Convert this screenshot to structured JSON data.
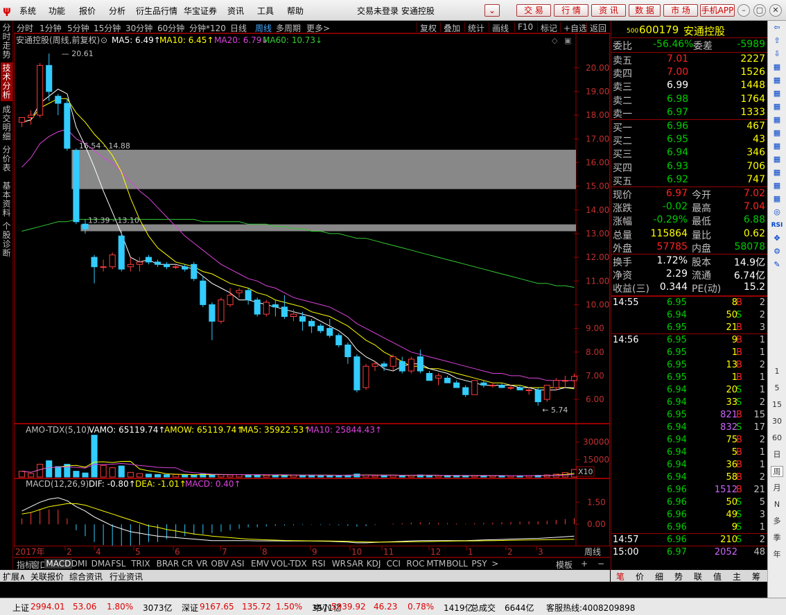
{
  "menu": [
    "系统",
    "功能",
    "报价",
    "分析",
    "衍生品行情",
    "华宝证券",
    "资讯",
    "工具",
    "帮助"
  ],
  "window_title": "交易未登录  安通控股",
  "top_buttons": [
    "交 易",
    "行 情",
    "资 讯",
    "数 据",
    "市 场",
    "手机APP"
  ],
  "left_tabs": [
    "分时走势",
    "技术分析",
    "成交明细",
    "分价表",
    "基本资料",
    "个股诊断"
  ],
  "periods": [
    "分时",
    "1分钟",
    "5分钟",
    "15分钟",
    "30分钟",
    "60分钟",
    "分钟*120",
    "日线",
    "周线",
    "多周期",
    "更多>"
  ],
  "right_tools": [
    "复权",
    "叠加",
    "统计",
    "画线",
    "F10",
    "标记",
    "+自选",
    "返回"
  ],
  "chart_header": {
    "name": "安通控股(周线,前复权)",
    "ma5": "MA5: 6.49↑",
    "ma10": "MA10: 6.45↑",
    "ma20": "MA20: 6.79↓",
    "ma60": "MA60: 10.73↓"
  },
  "annotations": {
    "high": "20.61",
    "low": "5.74",
    "gap1": "16.54 - 14.88",
    "gap2": "13.39 - 13.10"
  },
  "vol_header": {
    "name": "AMO-TDX(5,10)",
    "vamo": "VAMO: 65119.74↑",
    "amow": "AMOW: 65119.74↑",
    "ma5": "MA5: 35922.53↑",
    "ma10": "MA10: 25844.43↑",
    "x10": "X10"
  },
  "macd_header": {
    "name": "MACD(12,26,9)",
    "dif": "DIF: -0.80↑",
    "dea": "DEA: -1.01↑",
    "macd": "MACD: 0.40↑"
  },
  "x_labels": [
    "2017年",
    "2",
    "4",
    "5",
    "6",
    "7",
    "8",
    "9",
    "10",
    "11",
    "12",
    "1",
    "2",
    "3"
  ],
  "bottom_right_label": "周线",
  "indicator_tabs": [
    "指标",
    "窗口",
    "MACD",
    "DMI",
    "DMA",
    "FSL",
    "TRIX",
    "BRAR",
    "CR",
    "VR",
    "OBV",
    "ASI",
    "EMV",
    "VOL-TDX",
    "RSI",
    "WR",
    "SAR",
    "KDJ",
    "CCI",
    "ROC",
    "MTM",
    "BOLL",
    "PSY",
    ">"
  ],
  "template_label": "模板",
  "bottom_links": [
    "扩展∧",
    "关联报价",
    "综合资讯",
    "行业资讯"
  ],
  "quote": {
    "code": "600179",
    "name": "安通控股",
    "badge": "500",
    "webi_label": "委比",
    "webi": "-56.46%",
    "wecha_label": "委差",
    "wecha": "-5989",
    "sell": [
      {
        "label": "卖五",
        "price": "7.01",
        "vol": "2227"
      },
      {
        "label": "卖四",
        "price": "7.00",
        "vol": "1526"
      },
      {
        "label": "卖三",
        "price": "6.99",
        "vol": "1448"
      },
      {
        "label": "卖二",
        "price": "6.98",
        "vol": "1764"
      },
      {
        "label": "卖一",
        "price": "6.97",
        "vol": "1333"
      }
    ],
    "buy": [
      {
        "label": "买一",
        "price": "6.96",
        "vol": "467"
      },
      {
        "label": "买二",
        "price": "6.95",
        "vol": "43"
      },
      {
        "label": "买三",
        "price": "6.94",
        "vol": "346"
      },
      {
        "label": "买四",
        "price": "6.93",
        "vol": "706"
      },
      {
        "label": "买五",
        "price": "6.92",
        "vol": "747"
      }
    ],
    "stats": [
      {
        "l1": "现价",
        "v1": "6.97",
        "l2": "今开",
        "v2": "7.02"
      },
      {
        "l1": "涨跌",
        "v1": "-0.02",
        "l2": "最高",
        "v2": "7.04"
      },
      {
        "l1": "涨幅",
        "v1": "-0.29%",
        "l2": "最低",
        "v2": "6.88"
      },
      {
        "l1": "总量",
        "v1": "115864",
        "l2": "量比",
        "v2": "0.62"
      },
      {
        "l1": "外盘",
        "v1": "57785",
        "l2": "内盘",
        "v2": "58078"
      }
    ],
    "fund": [
      {
        "l1": "换手",
        "v1": "1.72%",
        "l2": "股本",
        "v2": "14.9亿"
      },
      {
        "l1": "净资",
        "v1": "2.29",
        "l2": "流通",
        "v2": "6.74亿"
      },
      {
        "l1": "收益(三)",
        "v1": "0.344",
        "l2": "PE(动)",
        "v2": "15.2"
      }
    ]
  },
  "ticks": [
    {
      "time": "14:55",
      "price": "6.95",
      "vol": "8",
      "bs": "B",
      "n": "2"
    },
    {
      "time": "",
      "price": "6.94",
      "vol": "50",
      "bs": "S",
      "n": "2"
    },
    {
      "time": "",
      "price": "6.95",
      "vol": "21",
      "bs": "B",
      "n": "3"
    },
    {
      "time": "14:56",
      "price": "6.95",
      "vol": "9",
      "bs": "B",
      "n": "1"
    },
    {
      "time": "",
      "price": "6.95",
      "vol": "1",
      "bs": "B",
      "n": "1"
    },
    {
      "time": "",
      "price": "6.95",
      "vol": "13",
      "bs": "B",
      "n": "2"
    },
    {
      "time": "",
      "price": "6.95",
      "vol": "1",
      "bs": "B",
      "n": "1"
    },
    {
      "time": "",
      "price": "6.94",
      "vol": "20",
      "bs": "S",
      "n": "1"
    },
    {
      "time": "",
      "price": "6.94",
      "vol": "33",
      "bs": "S",
      "n": "2"
    },
    {
      "time": "",
      "price": "6.95",
      "vol": "821",
      "bs": "B",
      "n": "15"
    },
    {
      "time": "",
      "price": "6.94",
      "vol": "832",
      "bs": "S",
      "n": "17"
    },
    {
      "time": "",
      "price": "6.94",
      "vol": "75",
      "bs": "B",
      "n": "2"
    },
    {
      "time": "",
      "price": "6.94",
      "vol": "5",
      "bs": "B",
      "n": "1"
    },
    {
      "time": "",
      "price": "6.94",
      "vol": "36",
      "bs": "B",
      "n": "1"
    },
    {
      "time": "",
      "price": "6.94",
      "vol": "58",
      "bs": "B",
      "n": "2"
    },
    {
      "time": "",
      "price": "6.96",
      "vol": "1512",
      "bs": "B",
      "n": "21"
    },
    {
      "time": "",
      "price": "6.96",
      "vol": "50",
      "bs": "S",
      "n": "5"
    },
    {
      "time": "",
      "price": "6.96",
      "vol": "49",
      "bs": "S",
      "n": "3"
    },
    {
      "time": "",
      "price": "6.96",
      "vol": "9",
      "bs": "S",
      "n": "1"
    },
    {
      "time": "14:57",
      "price": "6.96",
      "vol": "210",
      "bs": "S",
      "n": "2"
    },
    {
      "time": "15:00",
      "price": "6.97",
      "vol": "2052",
      "bs": "",
      "n": "48"
    }
  ],
  "right_bottom_tabs": [
    "笔",
    "价",
    "细",
    "势",
    "联",
    "值",
    "主",
    "筹"
  ],
  "tool_icons": [
    "arrow-left-icon",
    "arrow-up-icon",
    "arrow-down-icon",
    "grid-icon",
    "grid-icon",
    "grid-icon",
    "grid-icon",
    "grid-icon",
    "grid-icon",
    "grid-icon",
    "grid-icon",
    "grid-icon",
    "grid-icon",
    "grid-icon",
    "circle-icon",
    "RSI",
    "cross-icon",
    "tool-icon",
    "pen-icon"
  ],
  "tool_labels": [
    "1",
    "5",
    "15",
    "30",
    "60",
    "日",
    "周",
    "月",
    "N",
    "多",
    "季",
    "年"
  ],
  "index_bar": [
    {
      "name": "上证",
      "val": "2994.01",
      "chg": "53.06",
      "pct": "1.80%",
      "amt": "3073亿"
    },
    {
      "name": "深证",
      "val": "9167.65",
      "chg": "135.72",
      "pct": "1.50%",
      "amt": "3571亿"
    },
    {
      "name": "中小",
      "val": "5939.92",
      "chg": "46.23",
      "pct": "0.78%",
      "amt": "1419亿"
    }
  ],
  "total_label": "总成交",
  "total_amt": "6644亿",
  "hotline": "客服热线:4008209898",
  "chart_data": {
    "type": "candlestick",
    "y_ticks": [
      "20.00",
      "19.00",
      "18.00",
      "17.00",
      "16.00",
      "15.00",
      "14.00",
      "13.00",
      "12.00",
      "11.00",
      "10.00",
      "9.00",
      "8.00",
      "7.00",
      "6.00"
    ],
    "ylim": [
      5.3,
      20.9
    ],
    "vol_ticks": [
      "30000",
      "15000"
    ],
    "vol_ylim": [
      0,
      37000
    ],
    "macd_ticks": [
      "1.50",
      "0.00"
    ],
    "macd_ylim": [
      -1.35,
      2.5
    ],
    "candles": [
      [
        17.7,
        17.9,
        17.5,
        17.9
      ],
      [
        17.9,
        18.2,
        17.6,
        18.0
      ],
      [
        18.0,
        20.2,
        17.9,
        20.1
      ],
      [
        20.1,
        20.6,
        18.6,
        19.0
      ],
      [
        18.8,
        18.9,
        18.0,
        18.5
      ],
      [
        18.5,
        18.7,
        16.5,
        16.6
      ],
      [
        16.5,
        16.6,
        13.4,
        13.5
      ],
      [
        13.4,
        13.6,
        13.0,
        13.2
      ],
      [
        12.0,
        12.1,
        10.9,
        11.6
      ],
      [
        11.6,
        11.9,
        11.4,
        11.6
      ],
      [
        11.6,
        12.2,
        11.5,
        12.1
      ],
      [
        12.9,
        13.1,
        11.4,
        11.5
      ],
      [
        11.6,
        12.0,
        11.4,
        11.7
      ],
      [
        11.7,
        12.0,
        11.4,
        11.8
      ],
      [
        12.0,
        12.1,
        11.7,
        11.8
      ],
      [
        11.8,
        11.9,
        11.6,
        11.7
      ],
      [
        11.7,
        11.8,
        11.5,
        11.6
      ],
      [
        11.6,
        11.7,
        11.5,
        11.6
      ],
      [
        11.6,
        11.7,
        11.4,
        11.5
      ],
      [
        11.7,
        11.8,
        11.0,
        11.1
      ],
      [
        11.0,
        11.2,
        9.9,
        10.0
      ],
      [
        10.0,
        10.1,
        8.5,
        9.3
      ],
      [
        9.3,
        10.3,
        9.2,
        10.2
      ],
      [
        10.0,
        10.7,
        9.9,
        10.4
      ],
      [
        10.5,
        10.7,
        10.3,
        10.6
      ],
      [
        10.6,
        10.7,
        10.0,
        10.2
      ],
      [
        10.2,
        10.3,
        9.5,
        9.6
      ],
      [
        9.6,
        10.2,
        9.5,
        10.1
      ],
      [
        10.0,
        10.2,
        9.5,
        9.9
      ],
      [
        9.9,
        10.4,
        9.4,
        9.5
      ],
      [
        9.5,
        9.8,
        9.3,
        9.6
      ],
      [
        9.5,
        9.7,
        8.9,
        9.3
      ],
      [
        9.3,
        9.4,
        8.8,
        9.1
      ],
      [
        9.1,
        9.2,
        8.8,
        8.9
      ],
      [
        9.0,
        9.4,
        8.6,
        8.7
      ],
      [
        8.7,
        8.8,
        8.2,
        8.3
      ],
      [
        8.3,
        8.4,
        7.5,
        7.8
      ],
      [
        7.8,
        7.9,
        6.3,
        6.4
      ],
      [
        6.5,
        7.5,
        6.4,
        7.4
      ],
      [
        7.4,
        7.6,
        7.2,
        7.5
      ],
      [
        7.5,
        7.6,
        7.2,
        7.4
      ],
      [
        7.4,
        7.9,
        7.2,
        7.8
      ],
      [
        7.6,
        7.8,
        7.1,
        7.2
      ],
      [
        7.2,
        7.8,
        7.1,
        7.7
      ],
      [
        7.8,
        8.1,
        7.1,
        7.2
      ],
      [
        7.1,
        7.2,
        6.8,
        6.8
      ],
      [
        6.9,
        7.1,
        6.6,
        7.0
      ],
      [
        6.9,
        7.0,
        6.7,
        6.7
      ],
      [
        6.7,
        6.8,
        6.5,
        6.5
      ],
      [
        6.5,
        6.6,
        6.1,
        6.2
      ],
      [
        6.2,
        6.8,
        6.2,
        6.8
      ],
      [
        6.7,
        6.8,
        6.5,
        6.6
      ],
      [
        6.6,
        6.7,
        6.5,
        6.6
      ],
      [
        6.6,
        6.7,
        6.5,
        6.5
      ],
      [
        6.5,
        6.6,
        6.4,
        6.5
      ],
      [
        6.5,
        6.6,
        6.4,
        6.4
      ],
      [
        6.4,
        6.5,
        6.2,
        6.4
      ],
      [
        6.4,
        6.5,
        5.74,
        5.9
      ],
      [
        6.0,
        6.6,
        5.9,
        6.6
      ],
      [
        6.5,
        6.9,
        6.4,
        6.8
      ],
      [
        6.8,
        7.0,
        6.5,
        6.8
      ],
      [
        6.8,
        7.1,
        6.5,
        6.97
      ]
    ],
    "volumes": [
      5000,
      3000,
      11000,
      14000,
      9000,
      11000,
      5000,
      3500,
      36000,
      10000,
      8000,
      9500,
      4000,
      3000,
      2500,
      2200,
      2000,
      2200,
      2000,
      1800,
      2500,
      2200,
      2000,
      1800,
      2000,
      1900,
      1700,
      1500,
      1600,
      1800,
      1700,
      1600,
      1500,
      1400,
      1500,
      1400,
      1600,
      2600,
      1800,
      1300,
      1200,
      1600,
      1300,
      1500,
      1800,
      1200,
      1300,
      1200,
      1100,
      1300,
      1400,
      1200,
      1200,
      1100,
      1100,
      1200,
      1300,
      1500,
      1800,
      2400,
      3800,
      6500
    ],
    "ma5": [
      17.7,
      17.8,
      18.5,
      18.8,
      19.1,
      18.9,
      17.5,
      16.7,
      15.8,
      14.8,
      13.9,
      13.0,
      12.0,
      11.8,
      11.9,
      11.7,
      11.7,
      11.7,
      11.6,
      11.5,
      11.2,
      10.9,
      10.7,
      10.5,
      10.2,
      10.2,
      10.1,
      10.0,
      9.9,
      9.8,
      9.7,
      9.6,
      9.5,
      9.3,
      9.1,
      8.9,
      8.6,
      8.1,
      7.8,
      7.6,
      7.3,
      7.2,
      7.4,
      7.5,
      7.5,
      7.3,
      7.2,
      7.1,
      6.9,
      6.8,
      6.7,
      6.6,
      6.6,
      6.6,
      6.6,
      6.5,
      6.5,
      6.4,
      6.4,
      6.4,
      6.5,
      6.49
    ],
    "ma10": [
      17.7,
      17.8,
      18.3,
      18.5,
      18.7,
      18.7,
      18.1,
      17.7,
      17.2,
      16.8,
      16.3,
      15.6,
      14.5,
      13.6,
      12.9,
      12.4,
      12.1,
      11.8,
      11.7,
      11.6,
      11.4,
      11.3,
      11.1,
      10.9,
      10.8,
      10.7,
      10.5,
      10.4,
      10.2,
      10.1,
      10.0,
      9.9,
      9.7,
      9.6,
      9.5,
      9.3,
      9.1,
      8.8,
      8.5,
      8.3,
      8.0,
      7.8,
      7.6,
      7.4,
      7.4,
      7.3,
      7.3,
      7.2,
      7.1,
      7.0,
      6.9,
      6.8,
      6.7,
      6.7,
      6.6,
      6.6,
      6.5,
      6.5,
      6.5,
      6.5,
      6.5,
      6.45
    ],
    "ma20": [
      15.8,
      16.2,
      16.8,
      17.1,
      17.3,
      17.4,
      17.0,
      16.8,
      16.5,
      16.2,
      16.0,
      15.6,
      15.2,
      14.8,
      14.5,
      14.1,
      13.7,
      13.3,
      12.9,
      12.6,
      12.3,
      12.0,
      11.7,
      11.5,
      11.3,
      11.1,
      11.0,
      10.8,
      10.7,
      10.5,
      10.3,
      10.2,
      10.1,
      10.0,
      9.9,
      9.7,
      9.5,
      9.2,
      9.0,
      8.8,
      8.6,
      8.4,
      8.2,
      8.0,
      7.9,
      7.8,
      7.7,
      7.6,
      7.5,
      7.4,
      7.3,
      7.2,
      7.1,
      7.1,
      7.0,
      7.0,
      6.9,
      6.9,
      6.8,
      6.8,
      6.8,
      6.79
    ],
    "ma60": [
      13.1,
      13.2,
      13.3,
      13.4,
      13.5,
      13.5,
      13.6,
      13.6,
      13.6,
      13.6,
      13.6,
      13.6,
      13.6,
      13.6,
      13.6,
      13.6,
      13.6,
      13.6,
      13.6,
      13.6,
      13.5,
      13.5,
      13.5,
      13.5,
      13.5,
      13.4,
      13.4,
      13.4,
      13.3,
      13.3,
      13.2,
      13.2,
      13.1,
      13.1,
      13.0,
      13.0,
      12.9,
      12.8,
      12.8,
      12.7,
      12.6,
      12.5,
      12.4,
      12.3,
      12.2,
      12.1,
      12.0,
      11.9,
      11.8,
      11.7,
      11.6,
      11.5,
      11.4,
      11.3,
      11.2,
      11.1,
      11.0,
      10.9,
      10.9,
      10.8,
      10.8,
      10.73
    ],
    "macd_dif": [
      0.9,
      1.2,
      1.5,
      1.7,
      1.8,
      1.6,
      1.2,
      0.9,
      0.5,
      0.2,
      -0.1,
      -0.3,
      -0.5,
      -0.6,
      -0.7,
      -0.8,
      -0.85,
      -0.9,
      -0.95,
      -1.0,
      -1.05,
      -1.1,
      -1.1,
      -1.1,
      -1.1,
      -1.1,
      -1.12,
      -1.12,
      -1.12,
      -1.13,
      -1.13,
      -1.13,
      -1.13,
      -1.14,
      -1.15,
      -1.17,
      -1.2,
      -1.25,
      -1.25,
      -1.22,
      -1.2,
      -1.17,
      -1.15,
      -1.12,
      -1.1,
      -1.1,
      -1.1,
      -1.1,
      -1.1,
      -1.1,
      -1.08,
      -1.06,
      -1.04,
      -1.02,
      -1.0,
      -0.98,
      -0.96,
      -0.95,
      -0.92,
      -0.88,
      -0.84,
      -0.8
    ],
    "macd_dea": [
      0.7,
      0.8,
      1.0,
      1.2,
      1.3,
      1.4,
      1.4,
      1.3,
      1.1,
      0.9,
      0.7,
      0.5,
      0.3,
      0.1,
      -0.1,
      -0.2,
      -0.35,
      -0.45,
      -0.55,
      -0.65,
      -0.72,
      -0.8,
      -0.85,
      -0.9,
      -0.95,
      -1.0,
      -1.02,
      -1.05,
      -1.07,
      -1.09,
      -1.1,
      -1.11,
      -1.12,
      -1.12,
      -1.13,
      -1.14,
      -1.15,
      -1.17,
      -1.19,
      -1.2,
      -1.2,
      -1.2,
      -1.19,
      -1.18,
      -1.17,
      -1.16,
      -1.15,
      -1.14,
      -1.13,
      -1.12,
      -1.12,
      -1.11,
      -1.1,
      -1.09,
      -1.08,
      -1.07,
      -1.06,
      -1.05,
      -1.04,
      -1.03,
      -1.02,
      -1.01
    ]
  }
}
